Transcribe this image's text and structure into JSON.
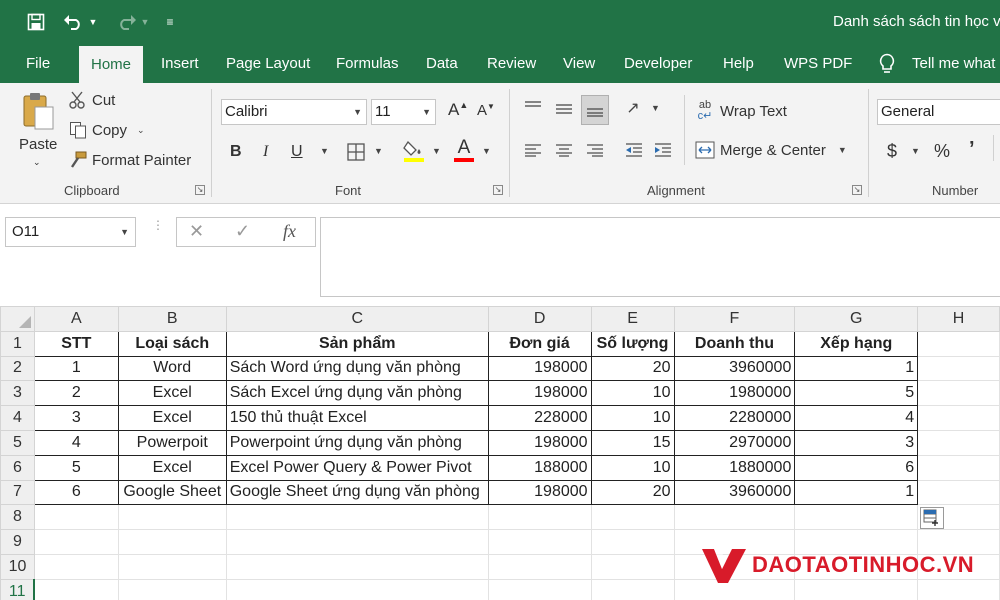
{
  "window": {
    "title": "Danh sách sách tin học v",
    "theme_color": "#217346"
  },
  "qat": {
    "icons": [
      "save-icon",
      "undo-icon",
      "redo-icon",
      "customize-icon"
    ]
  },
  "tabs": [
    {
      "label": "File"
    },
    {
      "label": "Home",
      "active": true
    },
    {
      "label": "Insert"
    },
    {
      "label": "Page Layout"
    },
    {
      "label": "Formulas"
    },
    {
      "label": "Data"
    },
    {
      "label": "Review"
    },
    {
      "label": "View"
    },
    {
      "label": "Developer"
    },
    {
      "label": "Help"
    },
    {
      "label": "WPS PDF"
    },
    {
      "label": "Tell me what"
    }
  ],
  "ribbon": {
    "clipboard": {
      "paste": "Paste",
      "cut": "Cut",
      "copy": "Copy",
      "format_painter": "Format Painter",
      "label": "Clipboard"
    },
    "font": {
      "name": "Calibri",
      "size": "11",
      "bold": "B",
      "italic": "I",
      "underline": "U",
      "label": "Font",
      "fill_color": "#ffff00",
      "font_color": "#ff0000"
    },
    "alignment": {
      "wrap_text": "Wrap Text",
      "merge_center": "Merge & Center",
      "label": "Alignment"
    },
    "number": {
      "format": "General",
      "currency": "$",
      "percent": "%",
      "comma": "’",
      "label": "Number"
    }
  },
  "formula_bar": {
    "name_box": "O11",
    "fx": "fx",
    "value": ""
  },
  "sheet": {
    "columns": [
      "A",
      "B",
      "C",
      "D",
      "E",
      "F",
      "G",
      "H"
    ],
    "row_numbers": [
      "1",
      "2",
      "3",
      "4",
      "5",
      "6",
      "7",
      "8",
      "9",
      "10",
      "11"
    ],
    "headers": [
      "STT",
      "Loại sách",
      "Sản phẩm",
      "Đơn giá",
      "Số lượng",
      "Doanh thu",
      "Xếp hạng"
    ],
    "rows": [
      [
        "1",
        "Word",
        "Sách Word ứng dụng văn phòng",
        "198000",
        "20",
        "3960000",
        "1"
      ],
      [
        "2",
        "Excel",
        "Sách Excel ứng dụng văn phòng",
        "198000",
        "10",
        "1980000",
        "5"
      ],
      [
        "3",
        "Excel",
        "150 thủ thuật Excel",
        "228000",
        "10",
        "2280000",
        "4"
      ],
      [
        "4",
        "Powerpoit",
        "Powerpoint ứng dụng văn phòng",
        "198000",
        "15",
        "2970000",
        "3"
      ],
      [
        "5",
        "Excel",
        "Excel Power Query & Power Pivot",
        "188000",
        "10",
        "1880000",
        "6"
      ],
      [
        "6",
        "Google Sheet",
        "Google Sheet ứng dụng văn phòng",
        "198000",
        "20",
        "3960000",
        "1"
      ]
    ]
  },
  "watermark": {
    "text": "DAOTAOTINHOC.VN",
    "color": "#d81b2a"
  }
}
